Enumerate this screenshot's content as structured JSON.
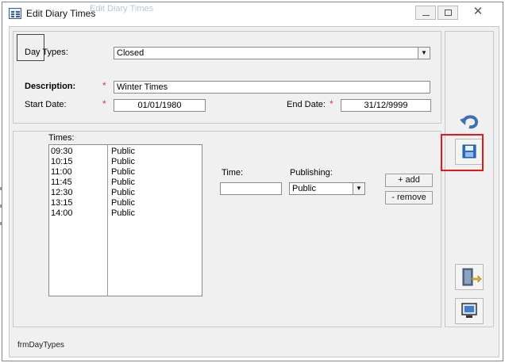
{
  "window": {
    "title": "Edit Diary Times",
    "ghost_title": "Edit Diary Times",
    "close_glyph": "✕",
    "form_name": "frmDayTypes"
  },
  "fields": {
    "day_types": {
      "label": "Day Types:",
      "value": "Closed"
    },
    "description": {
      "label": "Description:",
      "value": "Winter Times",
      "required_mark": "*"
    },
    "start_date": {
      "label": "Start Date:",
      "value": "01/01/1980",
      "required_mark": "*"
    },
    "end_date": {
      "label": "End Date:",
      "value": "31/12/9999",
      "required_mark": "*"
    }
  },
  "times": {
    "label": "Times:",
    "rows": [
      {
        "time": "09:30",
        "publishing": "Public"
      },
      {
        "time": "10:15",
        "publishing": "Public"
      },
      {
        "time": "11:00",
        "publishing": "Public"
      },
      {
        "time": "11:45",
        "publishing": "Public"
      },
      {
        "time": "12:30",
        "publishing": "Public"
      },
      {
        "time": "13:15",
        "publishing": "Public"
      },
      {
        "time": "14:00",
        "publishing": "Public"
      }
    ],
    "time_label": "Time:",
    "time_value": "",
    "publishing_label": "Publishing:",
    "publishing_value": "Public",
    "add_label": "+ add",
    "remove_label": "- remove"
  },
  "icons": {
    "undo": "undo-icon",
    "save": "save-icon",
    "exit": "exit-door-icon",
    "screen": "monitor-icon"
  },
  "colors": {
    "highlight": "#e01a1a",
    "required": "#e0303a",
    "form_background": "#f0f0f0"
  }
}
